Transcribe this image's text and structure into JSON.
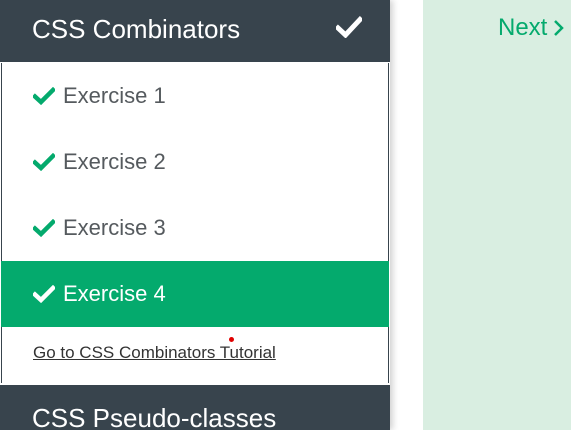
{
  "sidebar": {
    "section_title": "CSS Combinators",
    "items": [
      {
        "label": "Exercise 1",
        "completed": true,
        "active": false
      },
      {
        "label": "Exercise 2",
        "completed": true,
        "active": false
      },
      {
        "label": "Exercise 3",
        "completed": true,
        "active": false
      },
      {
        "label": "Exercise 4",
        "completed": true,
        "active": true
      }
    ],
    "tutorial_link": "Go to CSS Combinators Tutorial",
    "next_section_title": "CSS Pseudo-classes"
  },
  "content": {
    "next_label": "Next"
  },
  "icons": {
    "section_complete": "check-icon",
    "item_complete": "check-icon",
    "next_arrow": "chevron-right-icon"
  },
  "colors": {
    "header_bg": "#38444d",
    "accent_green": "#04aa6d",
    "content_bg": "#d9eee1",
    "item_text": "#555a5e"
  }
}
